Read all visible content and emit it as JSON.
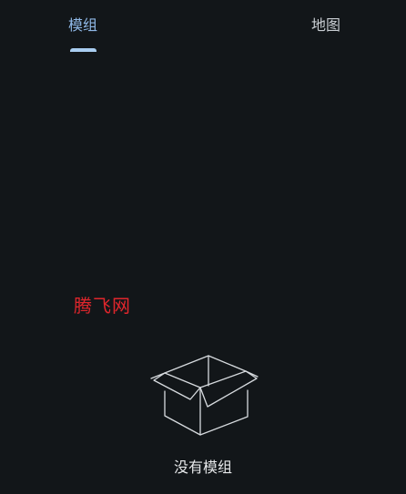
{
  "tabs": [
    {
      "label": "模组",
      "active": true
    },
    {
      "label": "地图",
      "active": false
    }
  ],
  "watermark": "腾飞网",
  "empty_state": {
    "icon": "open-box-icon",
    "message": "没有模组"
  },
  "colors": {
    "background": "#121619",
    "active_tab": "#8fb8e6",
    "indicator": "#a9cdf0",
    "inactive_tab": "#c9ced3",
    "watermark": "#e0262c",
    "icon_stroke": "#d7dbdf"
  }
}
